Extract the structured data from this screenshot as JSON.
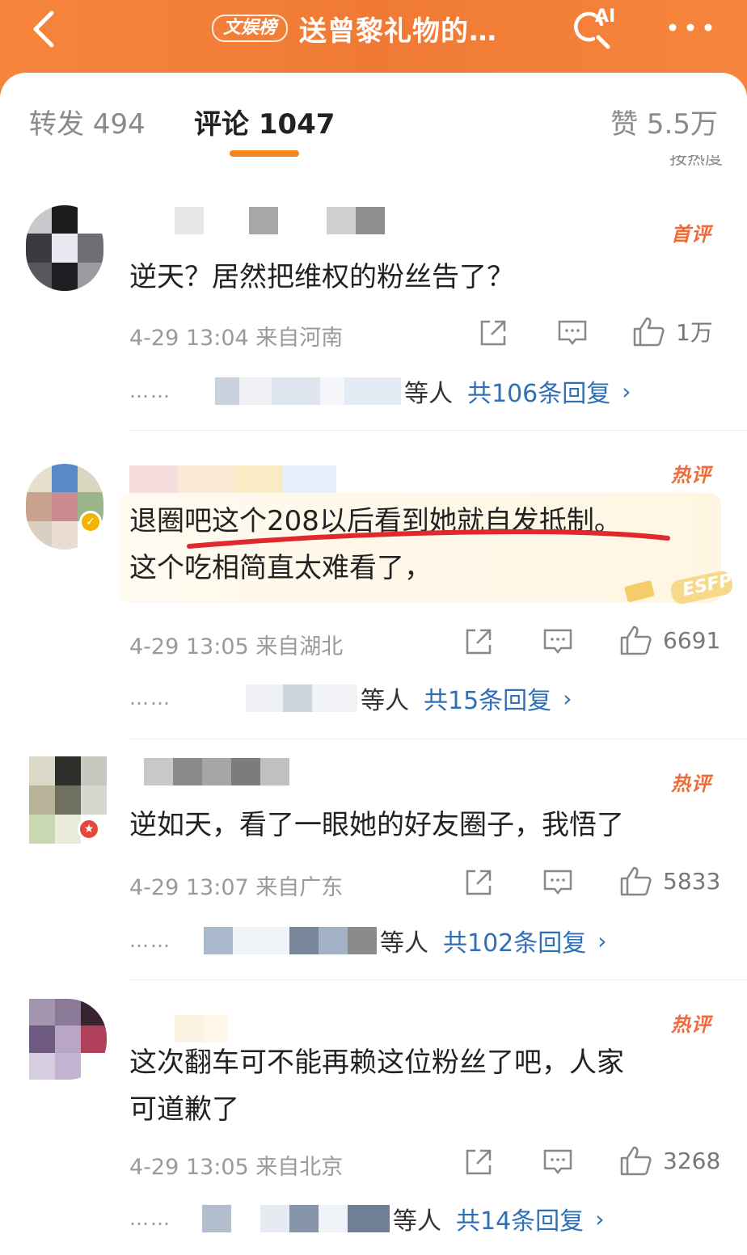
{
  "header": {
    "badge": "文娱榜",
    "title": "送曾黎礼物的…",
    "ai_label": "AI",
    "colors": {
      "bar": "#f07a35"
    }
  },
  "tabs": [
    {
      "label": "转发 494"
    },
    {
      "label": "评论 1047"
    },
    {
      "label": "赞 5.5万"
    }
  ],
  "sort_peek": "按热度",
  "comments": [
    {
      "tag": "首评",
      "text": "逆天？居然把维权的粉丝告了？",
      "meta": "4-29 13:04 来自河南",
      "likes": "1万",
      "reply_who": "等人",
      "reply_count": "共106条回复"
    },
    {
      "tag": "热评",
      "text_line1": "退圈吧这个208以后看到她就自发抵制。",
      "text_line2": "这个吃相简直太难看了，",
      "decoration": "ESFP",
      "meta": "4-29 13:05 来自湖北",
      "likes": "6691",
      "reply_who": "等人",
      "reply_count": "共15条回复"
    },
    {
      "tag": "热评",
      "text": "逆如天，看了一眼她的好友圈子，我悟了",
      "meta": "4-29 13:07 来自广东",
      "likes": "5833",
      "reply_who": "等人",
      "reply_count": "共102条回复"
    },
    {
      "tag": "热评",
      "text_line1": "这次翻车可不能再赖这位粉丝了吧，人家",
      "text_line2": "可道歉了",
      "meta": "4-29 13:05 来自北京",
      "likes": "3268",
      "reply_who": "等人",
      "reply_count": "共14条回复"
    }
  ],
  "reply_dots": "……",
  "chevron": "›"
}
